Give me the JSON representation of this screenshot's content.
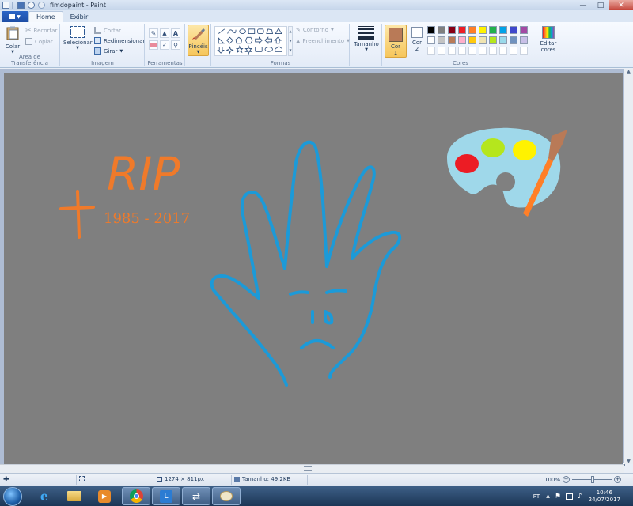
{
  "window": {
    "title": "fimdopaint - Paint"
  },
  "tabs": [
    {
      "label": "Home"
    },
    {
      "label": "Exibir"
    }
  ],
  "clipboard": {
    "label": "Área de Transferência",
    "paste": "Colar",
    "cut": "Recortar",
    "copy": "Copiar"
  },
  "image": {
    "label": "Imagem",
    "select": "Selecionar",
    "crop": "Cortar",
    "resize": "Redimensionar",
    "rotate": "Girar"
  },
  "tools": {
    "label": "Ferramentas"
  },
  "brushes": {
    "label": "Pincéis"
  },
  "shapes": {
    "label": "Formas",
    "outline": "Contorno",
    "fill": "Preenchimento"
  },
  "size": {
    "label": "Tamanho"
  },
  "colors": {
    "label": "Cores",
    "color1": "Cor",
    "color1_num": "1",
    "color2": "Cor",
    "color2_num": "2",
    "color1_value": "#b97a57",
    "color2_value": "#ffffff",
    "edit": "Editar",
    "edit2": "cores",
    "palette_row1": [
      "#000000",
      "#7f7f7f",
      "#880015",
      "#ed1c24",
      "#ff7f27",
      "#fff200",
      "#22b14c",
      "#00a2e8",
      "#3f48cc",
      "#a349a4"
    ],
    "palette_row2": [
      "#ffffff",
      "#c3c3c3",
      "#b97a57",
      "#ffaec9",
      "#ffc90e",
      "#efe4b0",
      "#b5e61d",
      "#99d9ea",
      "#7092be",
      "#c8bfe7"
    ]
  },
  "canvas_art": {
    "rip_text": "RIP",
    "years_text": "1985 - 2017",
    "orange": "#f07a2a",
    "blue": "#1c9ad8",
    "palette_board": "#9fd8ea"
  },
  "status": {
    "dimensions": "1274 × 811px",
    "size": "Tamanho: 49,2KB",
    "zoom": "100%"
  },
  "taskbar": {
    "lang": "PT",
    "time": "10:46",
    "date": "24/07/2017"
  }
}
